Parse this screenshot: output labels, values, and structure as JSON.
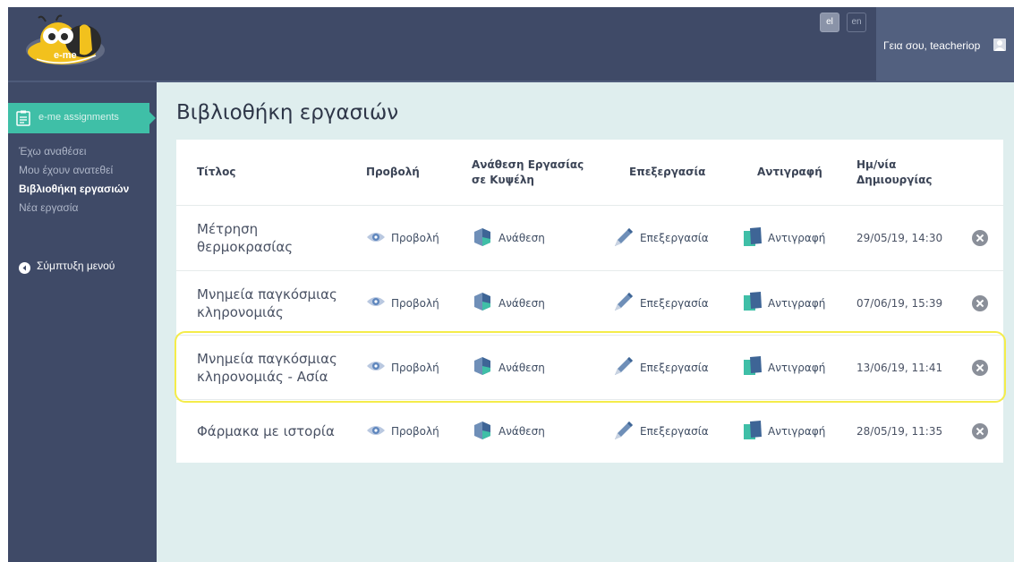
{
  "header": {
    "logo_text": "e-me",
    "lang_el": "el",
    "lang_en": "en",
    "greeting": "Γεια σου, teacheriop"
  },
  "sidebar": {
    "app_label": "e-me assignments",
    "items": [
      {
        "label": "Έχω αναθέσει",
        "active": false
      },
      {
        "label": "Μου έχουν ανατεθεί",
        "active": false
      },
      {
        "label": "Βιβλιοθήκη εργασιών",
        "active": true
      },
      {
        "label": "Νέα εργασία",
        "active": false
      }
    ],
    "collapse_label": "Σύμπτυξη μενού"
  },
  "main": {
    "title": "Βιβλιοθήκη εργασιών",
    "columns": {
      "title": "Τίτλος",
      "view": "Προβολή",
      "assign_line1": "Ανάθεση Εργασίας",
      "assign_line2": "σε Κυψέλη",
      "edit": "Επεξεργασία",
      "copy": "Αντιγραφή",
      "date_line1": "Ημ/νία",
      "date_line2": "Δημιουργίας"
    },
    "actions": {
      "view": "Προβολή",
      "assign": "Ανάθεση",
      "edit": "Επεξεργασία",
      "copy": "Αντιγραφή"
    },
    "rows": [
      {
        "title_line1": "Μέτρηση",
        "title_line2": "θερμοκρασίας",
        "date": "29/05/19, 14:30"
      },
      {
        "title_line1": "Μνημεία παγκόσμιας",
        "title_line2": "κληρονομιάς",
        "date": "07/06/19, 15:39"
      },
      {
        "title_line1": "Μνημεία παγκόσμιας",
        "title_line2": "κληρονομιάς - Ασία",
        "date": "13/06/19, 11:41",
        "highlighted": true
      },
      {
        "title_line1": "Φάρμακα με ιστορία",
        "title_line2": "",
        "date": "28/05/19, 11:35"
      }
    ]
  },
  "colors": {
    "header_bg": "#3f4a67",
    "accent": "#3fbfa7",
    "content_bg": "#dfeeee",
    "highlight": "#f4ec4a"
  }
}
